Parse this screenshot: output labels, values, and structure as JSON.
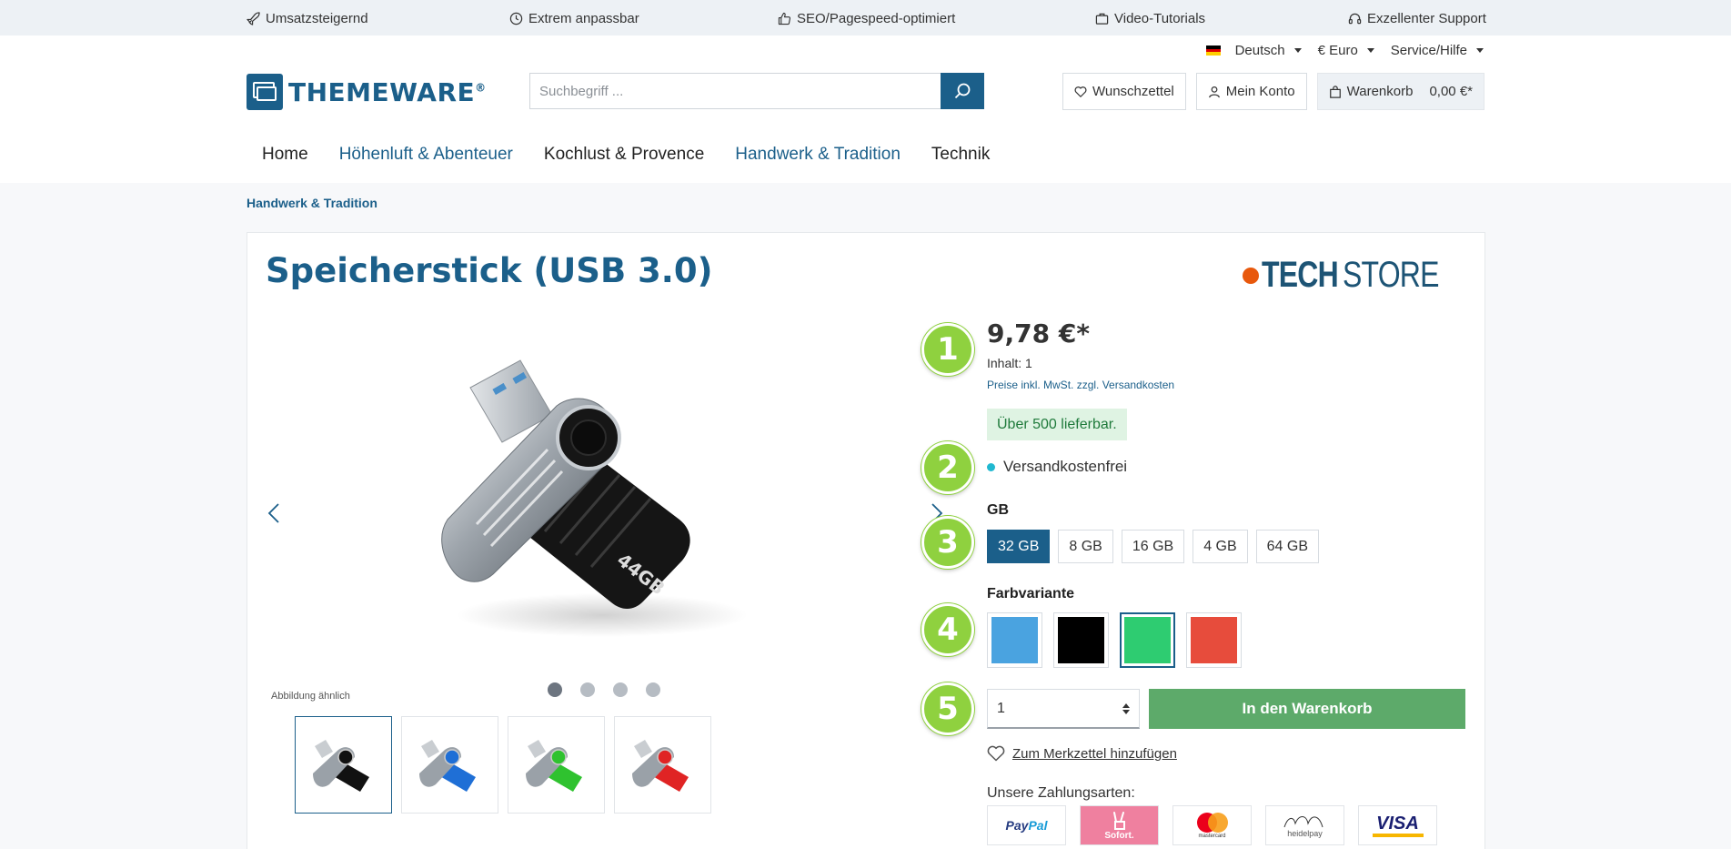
{
  "usp": [
    {
      "icon": "rocket-icon",
      "label": "Umsatzsteigernd"
    },
    {
      "icon": "clock-icon",
      "label": "Extrem anpassbar"
    },
    {
      "icon": "thumbs-up-icon",
      "label": "SEO/Pagespeed-optimiert"
    },
    {
      "icon": "briefcase-icon",
      "label": "Video-Tutorials"
    },
    {
      "icon": "headset-icon",
      "label": "Exzellenter Support"
    }
  ],
  "meta_nav": {
    "language": "Deutsch",
    "currency": "€ Euro",
    "service": "Service/Hilfe"
  },
  "logo": {
    "text": "THEMEWARE",
    "reg": "®"
  },
  "search": {
    "placeholder": "Suchbegriff ..."
  },
  "header_actions": {
    "wishlist": "Wunschzettel",
    "account": "Mein Konto",
    "cart": "Warenkorb",
    "cart_total": "0,00 €*"
  },
  "main_nav": [
    "Home",
    "Höhenluft & Abenteuer",
    "Kochlust & Provence",
    "Handwerk & Tradition",
    "Technik"
  ],
  "breadcrumb": "Handwerk & Tradition",
  "product": {
    "title": "Speicherstick (USB 3.0)",
    "brand_a": "TECH",
    "brand_b": "STORE",
    "image_note": "Abbildung ähnlich",
    "stick_label": "44GB",
    "price": "9,78 €*",
    "content": "Inhalt: 1",
    "tax_note": "Preise inkl. MwSt. zzgl. Versandkosten",
    "stock": "Über 500 lieferbar.",
    "shipping": "Versandkostenfrei",
    "gb_label": "GB",
    "gb_options": [
      "32 GB",
      "8 GB",
      "16 GB",
      "4 GB",
      "64 GB"
    ],
    "gb_selected": "32 GB",
    "color_label": "Farbvariante",
    "colors": [
      "#4aa3e0",
      "#000000",
      "#2ecc71",
      "#e74c3c"
    ],
    "quantity": "1",
    "add_to_cart": "In den Warenkorb",
    "wishlist_add": "Zum Merkzettel hinzufügen",
    "payment_label": "Unsere Zahlungsarten:",
    "payments": {
      "paypal_a": "Pay",
      "paypal_b": "Pal",
      "sofort": "Sofort.",
      "mastercard": "mastercard",
      "heidelpay": "heidelpay",
      "visa": "VISA"
    }
  },
  "steps": [
    "1",
    "2",
    "3",
    "4",
    "5"
  ],
  "accent_color": "#1b5f8a",
  "step_color": "#8fd13f",
  "cart_button_color": "#5daa6a"
}
